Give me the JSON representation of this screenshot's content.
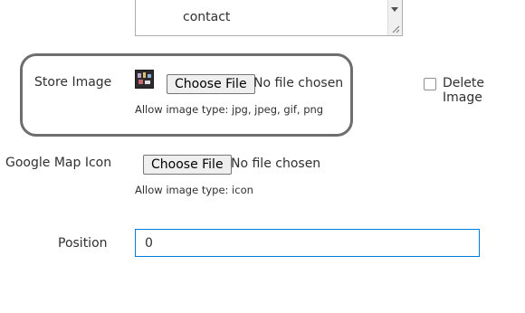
{
  "multiselect": {
    "group_label": "contact",
    "option_label": "contact"
  },
  "store_image": {
    "label": "Store Image",
    "choose_button": "Choose File",
    "no_file_text": "No file chosen",
    "note": "Allow image type: jpg, jpeg, gif, png",
    "delete_label": "Delete Image"
  },
  "google_map_icon": {
    "label": "Google Map Icon",
    "choose_button": "Choose File",
    "no_file_text": "No file chosen",
    "note": "Allow image type: icon"
  },
  "position": {
    "label": "Position",
    "value": "0"
  },
  "colors": {
    "focus_border": "#007bdb",
    "highlight_border": "#6e6e6e"
  }
}
